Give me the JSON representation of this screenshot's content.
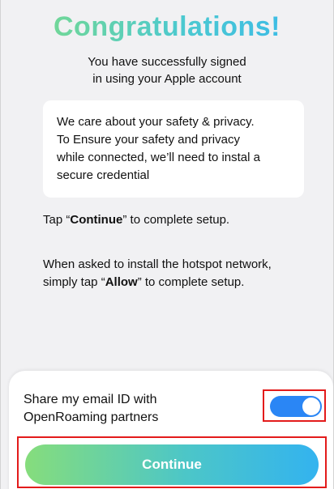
{
  "header": {
    "title": "Congratulations!",
    "subtitle_line1": "You have successfully signed",
    "subtitle_line2": "in using your Apple account"
  },
  "info_card": {
    "line1": "We care about your safety & privacy.",
    "line2": "To Ensure your safety and privacy",
    "line3": "while connected, we’ll need to instal a",
    "line4": "secure credential"
  },
  "instructions": {
    "tap_prefix": "Tap “",
    "tap_bold": "Continue",
    "tap_suffix": "” to complete setup.",
    "allow_line1": "When asked to install the hotspot network,",
    "allow_prefix": "simply tap “",
    "allow_bold": "Allow",
    "allow_suffix": "” to complete setup."
  },
  "share_email": {
    "label_line1": "Share my email ID with",
    "label_line2": "OpenRoaming partners",
    "enabled": true,
    "toggle_color": "#2a86f5"
  },
  "continue_button": {
    "label": "Continue"
  },
  "colors": {
    "highlight_border": "#e31b1b",
    "gradient_start": "#86dd7c",
    "gradient_end": "#33b3ef"
  }
}
